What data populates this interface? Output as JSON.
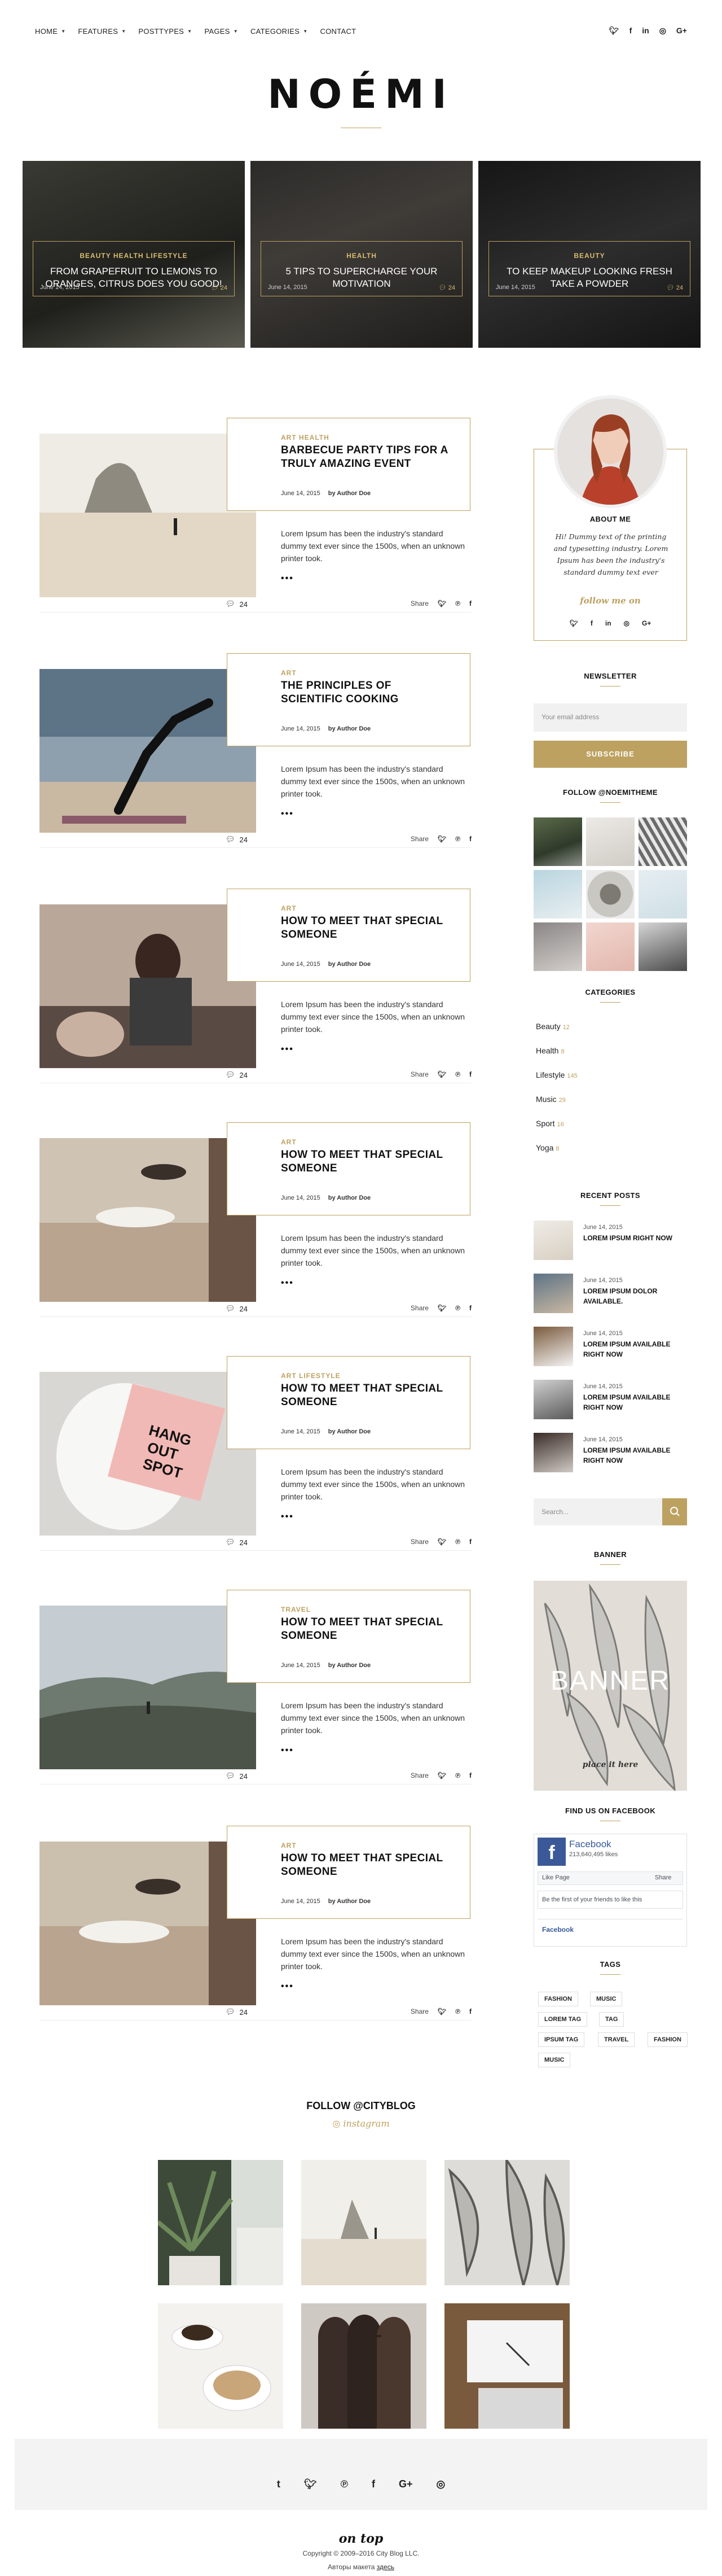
{
  "nav": {
    "items": [
      {
        "label": "HOME",
        "caret": true
      },
      {
        "label": "FEATURES",
        "caret": true
      },
      {
        "label": "POSTTYPES",
        "caret": true
      },
      {
        "label": "PAGES",
        "caret": true
      },
      {
        "label": "CATEGORIES",
        "caret": true
      },
      {
        "label": "CONTACT",
        "caret": false
      }
    ],
    "social": [
      "twitter-icon",
      "facebook-icon",
      "linkedin-icon",
      "instagram-icon",
      "rss-icon"
    ]
  },
  "logo": "NOÉMI",
  "hero": [
    {
      "category": "BEAUTY HEALTH LIFESTYLE",
      "title": "FROM GRAPEFRUIT TO LEMONS TO ORANGES, CITRUS DOES YOU GOOD!",
      "date": "June 14, 2015",
      "comments": "24"
    },
    {
      "category": "HEALTH",
      "title": "5 TIPS TO SUPERCHARGE YOUR MOTIVATION",
      "date": "June 14, 2015",
      "comments": "24"
    },
    {
      "category": "BEAUTY",
      "title": "TO KEEP MAKEUP LOOKING FRESH TAKE A POWDER",
      "date": "June 14, 2015",
      "comments": "24"
    }
  ],
  "posts": [
    {
      "category": "ART HEALTH",
      "title": "BARBECUE PARTY TIPS FOR A TRULY AMAZING EVENT",
      "date": "June 14, 2015",
      "author": "by Author Doe",
      "excerpt": "Lorem Ipsum has been the industry's standard dummy text ever since the 1500s, when an unknown printer took.",
      "more": "•••",
      "comments": "24",
      "share": "Share"
    },
    {
      "category": "ART",
      "title": "THE PRINCIPLES OF SCIENTIFIC COOKING",
      "date": "June 14, 2015",
      "author": "by Author Doe",
      "excerpt": "Lorem Ipsum has been the industry's standard dummy text ever since the 1500s, when an unknown printer took.",
      "more": "•••",
      "comments": "24",
      "share": "Share"
    },
    {
      "category": "ART",
      "title": "HOW TO MEET THAT SPECIAL SOMEONE",
      "date": "June 14, 2015",
      "author": "by Author Doe",
      "excerpt": "Lorem Ipsum has been the industry's standard dummy text ever since the 1500s, when an unknown printer took.",
      "more": "•••",
      "comments": "24",
      "share": "Share"
    },
    {
      "category": "ART",
      "title": "HOW TO MEET THAT SPECIAL SOMEONE",
      "date": "June 14, 2015",
      "author": "by Author Doe",
      "excerpt": "Lorem Ipsum has been the industry's standard dummy text ever since the 1500s, when an unknown printer took.",
      "more": "•••",
      "comments": "24",
      "share": "Share"
    },
    {
      "category": "ART LIFESTYLE",
      "title": "HOW TO MEET THAT SPECIAL SOMEONE",
      "date": "June 14, 2015",
      "author": "by Author Doe",
      "excerpt": "Lorem Ipsum has been the industry's standard dummy text ever since the 1500s, when an unknown printer took.",
      "more": "•••",
      "comments": "24",
      "share": "Share"
    },
    {
      "category": "TRAVEL",
      "title": "HOW TO MEET THAT SPECIAL SOMEONE",
      "date": "June 14, 2015",
      "author": "by Author Doe",
      "excerpt": "Lorem Ipsum has been the industry's standard dummy text ever since the 1500s, when an unknown printer took.",
      "more": "•••",
      "comments": "24",
      "share": "Share"
    },
    {
      "category": "ART",
      "title": "HOW TO MEET THAT SPECIAL SOMEONE",
      "date": "June 14, 2015",
      "author": "by Author Doe",
      "excerpt": "Lorem Ipsum has been the industry's standard dummy text ever since the 1500s, when an unknown printer took.",
      "more": "•••",
      "comments": "24",
      "share": "Share"
    }
  ],
  "sidebar": {
    "about": {
      "title": "ABOUT ME",
      "text": "Hi! Dummy text of the printing and typesetting industry. Lorem Ipsum has been the industry's standard dummy text ever",
      "signature": "follow me on"
    },
    "newsletter": {
      "title": "NEWSLETTER",
      "placeholder": "Your email address",
      "button": "SUBSCRIBE"
    },
    "instagram": {
      "title": "FOLLOW @NOEMITHEME"
    },
    "categories": {
      "title": "CATEGORIES",
      "items": [
        {
          "name": "Beauty",
          "count": "12"
        },
        {
          "name": "Health",
          "count": "8"
        },
        {
          "name": "Lifestyle",
          "count": "145"
        },
        {
          "name": "Music",
          "count": "29"
        },
        {
          "name": "Sport",
          "count": "16"
        },
        {
          "name": "Yoga",
          "count": "8"
        }
      ]
    },
    "recent": {
      "title": "RECENT POSTS",
      "items": [
        {
          "date": "June 14, 2015",
          "title": "LOREM IPSUM RIGHT NOW"
        },
        {
          "date": "June 14, 2015",
          "title": "LOREM IPSUM DOLOR AVAILABLE."
        },
        {
          "date": "June 14, 2015",
          "title": "LOREM IPSUM AVAILABLE RIGHT NOW"
        },
        {
          "date": "June 14, 2015",
          "title": "LOREM IPSUM AVAILABLE RIGHT NOW"
        },
        {
          "date": "June 14, 2015",
          "title": "LOREM IPSUM AVAILABLE RIGHT NOW"
        }
      ]
    },
    "search": {
      "placeholder": "Search..."
    },
    "banner": {
      "title": "BANNER",
      "text": "BANNER",
      "caption": "place it here"
    },
    "facebook": {
      "title": "FIND US ON FACEBOOK",
      "page": "Facebook",
      "likes": "213,640,495 likes",
      "like_btn": "Like Page",
      "share_btn": "Share",
      "friends": "Be the first of your friends to like this",
      "footer_name": "Facebook"
    },
    "tags": {
      "title": "TAGS",
      "items": [
        "FASHION",
        "MUSIC",
        "LOREM TAG",
        "TAG",
        "IPSUM TAG",
        "TRAVEL",
        "FASHION",
        "MUSIC"
      ]
    }
  },
  "follow": {
    "title": "FOLLOW @CITYBLOG",
    "sub": "instagram"
  },
  "footer": {
    "social": [
      "tumblr-icon",
      "twitter-icon",
      "pinterest-icon",
      "facebook-icon",
      "google-plus-icon",
      "instagram-icon"
    ],
    "logo": "on top",
    "copyright": "Copyright © 2009–2016 City Blog LLC.",
    "credit": "Авторы макета",
    "credit_link": "здесь"
  },
  "colors": {
    "accent": "#bda160",
    "dark": "#111111",
    "light_bg": "#f3f3f3"
  }
}
